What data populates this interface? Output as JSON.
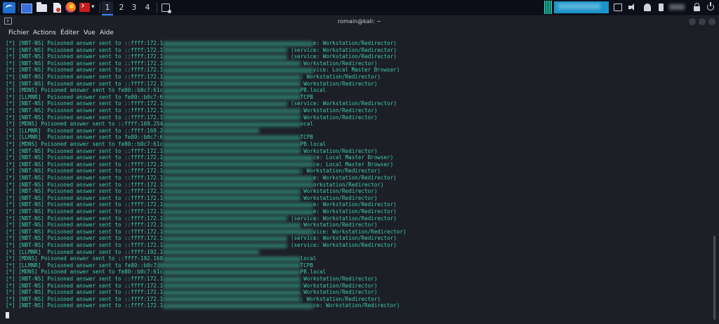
{
  "panel": {
    "workspaces": [
      "1",
      "2",
      "3",
      "4"
    ],
    "active_workspace": "1",
    "icons": [
      "kali-menu-icon",
      "desktop-icon",
      "file-manager-icon",
      "text-editor-icon",
      "firefox-icon",
      "terminal-app-icon",
      "chevron-down-icon",
      "screenshot-icon",
      "cpu-monitor-icon",
      "display-icon",
      "volume-icon",
      "notification-icon",
      "battery-icon",
      "lock-icon",
      "power-icon"
    ]
  },
  "window": {
    "title": "romain@kali: ~"
  },
  "menu": {
    "fichier": "Fichier",
    "actions": "Actions",
    "editer": "Éditer",
    "vue": "Vue",
    "aide": "Aide"
  },
  "terminal": {
    "lines": [
      {
        "tag": "[*]",
        "head": " [NBT-NS] Poisoned answer sent to ::ffff:172.1",
        "tail": "e: Workstation/Redirector)"
      },
      {
        "tag": "[*]",
        "head": " [NBT-NS] Poisoned answer sent to ::ffff:172.1",
        "tail": " (service: Workstation/Redirector)"
      },
      {
        "tag": "[*]",
        "head": " [NBT-NS] Poisoned answer sent to ::ffff:172.1",
        "tail": " (service: Workstation/Redirector)"
      },
      {
        "tag": "[*]",
        "head": " [NBT-NS] Poisoned answer sent to ::ffff:172.1",
        "tail": " Workstation/Redirector)"
      },
      {
        "tag": "[*]",
        "head": " [NBT-NS] Poisoned answer sent to ::ffff:172.1",
        "tail": "vice: Local Master Browser)"
      },
      {
        "tag": "[*]",
        "head": " [NBT-NS] Poisoned answer sent to ::ffff:172.1",
        "tail": ": Workstation/Redirector)"
      },
      {
        "tag": "[*]",
        "head": " [NBT-NS] Poisoned answer sent to ::ffff:172.1",
        "tail": " Workstation/Redirector)"
      },
      {
        "tag": "[*]",
        "head": " [MDNS] Poisoned answer sent to fe80::b0c7:61c",
        "tail": "PB.local"
      },
      {
        "tag": "[*]",
        "head": " [LLMNR]  Poisoned answer sent to fe80::b0c7:6",
        "tail": "TCPB"
      },
      {
        "tag": "[*]",
        "head": " [NBT-NS] Poisoned answer sent to ::ffff:172.1",
        "tail": " (service: Workstation/Redirector)"
      },
      {
        "tag": "[*]",
        "head": " [NBT-NS] Poisoned answer sent to ::ffff:172.1",
        "tail": " Workstation/Redirector)"
      },
      {
        "tag": "[*]",
        "head": " [NBT-NS] Poisoned answer sent to ::ffff:172.1",
        "tail": " Workstation/Redirector)"
      },
      {
        "tag": "[*]",
        "head": " [MDNS] Poisoned answer sent to ::ffff:169.254",
        "tail": "ocal"
      },
      {
        "tag": "[*]",
        "head": " [LLMNR]  Poisoned answer sent to ::ffff:169.2",
        "tail": ""
      },
      {
        "tag": "[*]",
        "head": " [LLMNR]  Poisoned answer sent to fe80::b0c7:6",
        "tail": "TCPB"
      },
      {
        "tag": "[*]",
        "head": " [MDNS] Poisoned answer sent to fe80::b0c7:61c",
        "tail": "PB.local"
      },
      {
        "tag": "[*]",
        "head": " [NBT-NS] Poisoned answer sent to ::ffff:172.1",
        "tail": " Workstation/Redirector)"
      },
      {
        "tag": "[*]",
        "head": " [NBT-NS] Poisoned answer sent to ::ffff:172.1",
        "tail": "ce: Local Master Browser)"
      },
      {
        "tag": "[*]",
        "head": " [NBT-NS] Poisoned answer sent to ::ffff:172.1",
        "tail": "ce: Local Master Browser)"
      },
      {
        "tag": "[*]",
        "head": " [NBT-NS] Poisoned answer sent to ::ffff:172.1",
        "tail": ": Workstation/Redirector)"
      },
      {
        "tag": "[*]",
        "head": " [NBT-NS] Poisoned answer sent to ::ffff:172.1",
        "tail": "e: Workstation/Redirector)"
      },
      {
        "tag": "[*]",
        "head": " [NBT-NS] Poisoned answer sent to ::ffff:172.1",
        "tail": "orkstation/Redirector)"
      },
      {
        "tag": "[*]",
        "head": " [NBT-NS] Poisoned answer sent to ::ffff:172.1",
        "tail": " Workstation/Redirector)"
      },
      {
        "tag": "[*]",
        "head": " [NBT-NS] Poisoned answer sent to ::ffff:172.1",
        "tail": " Workstation/Redirector)"
      },
      {
        "tag": "[*]",
        "head": " [NBT-NS] Poisoned answer sent to ::ffff:172.1",
        "tail": "e: Workstation/Redirector)"
      },
      {
        "tag": "[*]",
        "head": " [NBT-NS] Poisoned answer sent to ::ffff:172.1",
        "tail": "e: Workstation/Redirector)"
      },
      {
        "tag": "[*]",
        "head": " [NBT-NS] Poisoned answer sent to ::ffff:172.1",
        "tail": " (service: Workstation/Redirector)"
      },
      {
        "tag": "[*]",
        "head": " [NBT-NS] Poisoned answer sent to ::ffff:172.1",
        "tail": " Workstation/Redirector)"
      },
      {
        "tag": "[*]",
        "head": " [NBT-NS] Poisoned answer sent to ::ffff:172.1",
        "tail": "vice: Workstation/Redirector)"
      },
      {
        "tag": "[*]",
        "head": " [NBT-NS] Poisoned answer sent to ::ffff:172.1",
        "tail": " (service: Workstation/Redirector)"
      },
      {
        "tag": "[*]",
        "head": " [NBT-NS] Poisoned answer sent to ::ffff:172.1",
        "tail": " (service: Workstation/Redirector)"
      },
      {
        "tag": "[*]",
        "head": " [LLMNR]  Poisoned answer sent to ::ffff:192.1",
        "tail": ""
      },
      {
        "tag": "[*]",
        "head": " [MDNS] Poisoned answer sent to ::ffff:192.168",
        "tail": "local"
      },
      {
        "tag": "[*]",
        "head": " [LLMNR]  Poisoned answer sent to fe80::b0c7",
        "tail": "TCPB"
      },
      {
        "tag": "[*]",
        "head": " [MDNS] Poisoned answer sent to fe80::b0c7:61c",
        "tail": "PB.local"
      },
      {
        "tag": "[*]",
        "head": " [NBT-NS] Poisoned answer sent to ::ffff:172.1",
        "tail": " Workstation/Redirector)"
      },
      {
        "tag": "[*]",
        "head": " [NBT-NS] Poisoned answer sent to ::ffff:172.1",
        "tail": " Workstation/Redirector)"
      },
      {
        "tag": "[*]",
        "head": " [NBT-NS] Poisoned answer sent to ::ffff:172.1",
        "tail": " Workstation/Redirector)"
      },
      {
        "tag": "[*]",
        "head": " [NBT-NS] Poisoned answer sent to ::ffff:172.1",
        "tail": ": Workstation/Redirector)"
      },
      {
        "tag": "[*]",
        "head": " [NBT-NS] Poisoned answer sent to ::ffff:172.1",
        "tail": "ce: Workstation/Redirector)"
      }
    ]
  },
  "colors": {
    "terminal_bg": "#1d1f27",
    "text_green": "#3fcdae",
    "panel_bg": "#0c0f17",
    "accent": "#3a86ff"
  }
}
